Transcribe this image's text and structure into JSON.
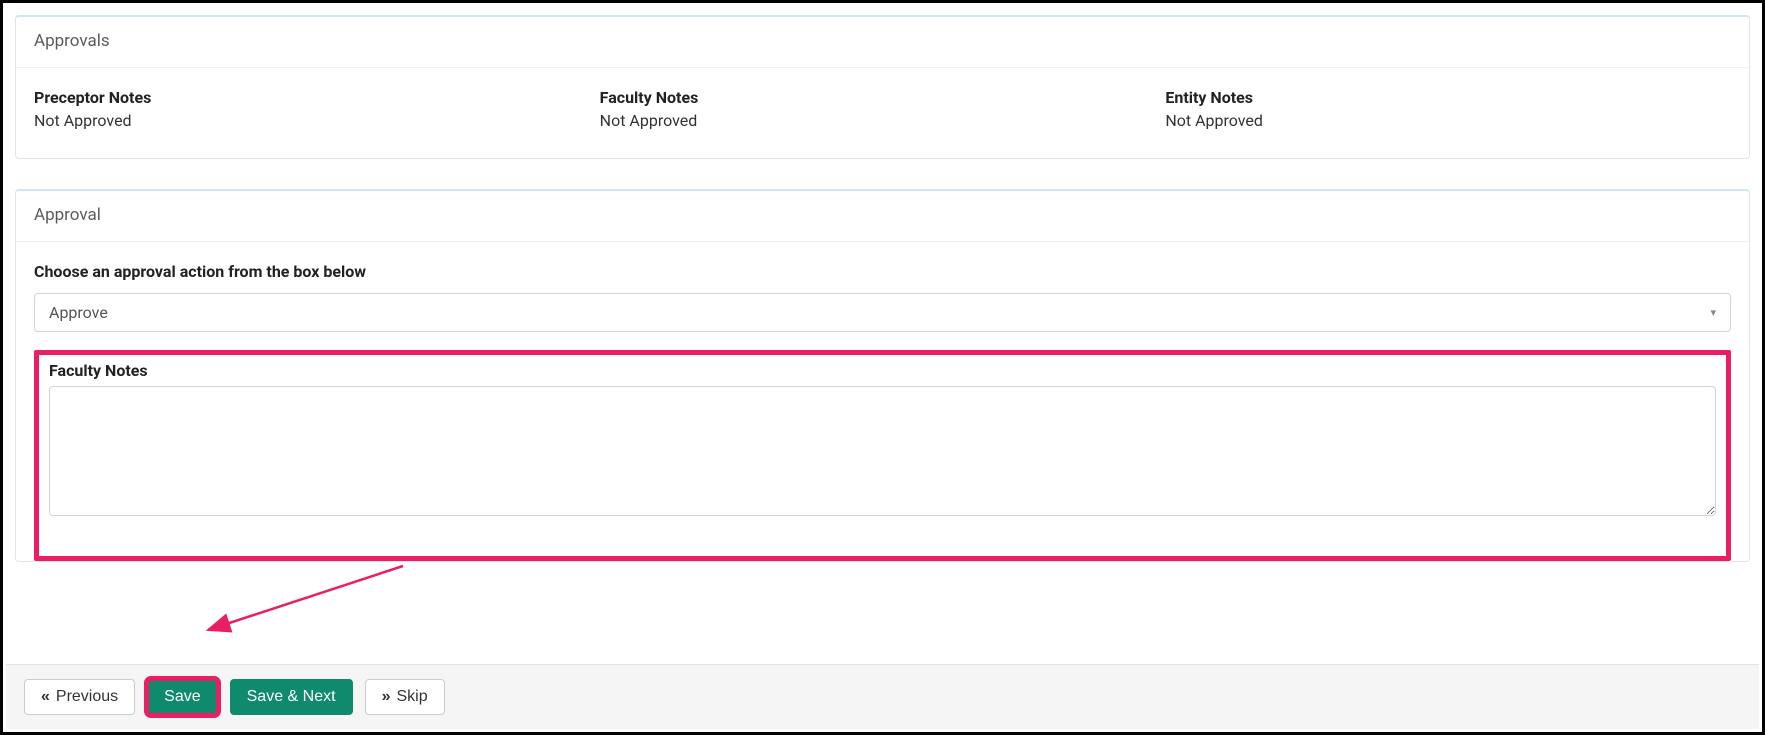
{
  "approvals_panel": {
    "title": "Approvals",
    "columns": [
      {
        "label": "Preceptor Notes",
        "value": "Not Approved"
      },
      {
        "label": "Faculty Notes",
        "value": "Not Approved"
      },
      {
        "label": "Entity Notes",
        "value": "Not Approved"
      }
    ]
  },
  "approval_panel": {
    "title": "Approval",
    "instruction": "Choose an approval action from the box below",
    "select": {
      "selected": "Approve"
    },
    "faculty_notes_label": "Faculty Notes",
    "faculty_notes_value": ""
  },
  "footer": {
    "previous_label": "Previous",
    "save_label": "Save",
    "save_next_label": "Save & Next",
    "skip_label": "Skip"
  }
}
